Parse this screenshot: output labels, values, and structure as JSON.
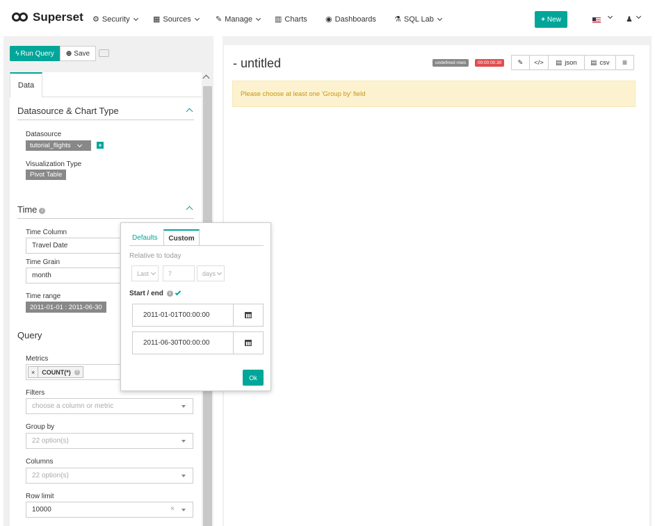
{
  "navbar": {
    "brand": "Superset",
    "items": [
      {
        "label": "Security",
        "icon": "gears-icon",
        "dropdown": true
      },
      {
        "label": "Sources",
        "icon": "table-icon",
        "dropdown": true
      },
      {
        "label": "Manage",
        "icon": "wrench-icon",
        "dropdown": true
      },
      {
        "label": "Charts",
        "icon": "bar-chart-icon",
        "dropdown": false
      },
      {
        "label": "Dashboards",
        "icon": "dashboard-icon",
        "dropdown": false
      },
      {
        "label": "SQL Lab",
        "icon": "flask-icon",
        "dropdown": true
      }
    ],
    "new_button": "New",
    "accent_color": "#00a699"
  },
  "toolbar": {
    "run_query": "Run Query",
    "save": "Save"
  },
  "sidebar": {
    "tab_label": "Data",
    "datasource_section": {
      "title": "Datasource & Chart Type",
      "datasource_label": "Datasource",
      "datasource_value": "tutorial_flights",
      "viz_type_label": "Visualization Type",
      "viz_type_value": "Pivot Table"
    },
    "time_section": {
      "title": "Time",
      "time_column_label": "Time Column",
      "time_column_value": "Travel Date",
      "time_grain_label": "Time Grain",
      "time_grain_value": "month",
      "time_range_label": "Time range",
      "time_range_value": "2011-01-01 : 2011-06-30"
    },
    "query_section": {
      "title": "Query",
      "metrics_label": "Metrics",
      "metric_value": "COUNT(*)",
      "filters_label": "Filters",
      "filters_placeholder": "choose a column or metric",
      "group_by_label": "Group by",
      "group_by_placeholder": "22 option(s)",
      "columns_label": "Columns",
      "columns_placeholder": "22 option(s)",
      "row_limit_label": "Row limit",
      "row_limit_value": "10000"
    }
  },
  "popover": {
    "tab_defaults": "Defaults",
    "tab_custom": "Custom",
    "relative_label": "Relative to today",
    "rel_last": "Last",
    "rel_num": "7",
    "rel_unit": "days",
    "start_end_label": "Start / end",
    "start_value": "2011-01-01T00:00:00",
    "end_value": "2011-06-30T00:00:00",
    "ok_label": "Ok"
  },
  "main": {
    "title": "- untitled",
    "rows_badge": "undefined rows",
    "timer_badge": "00:00:00.30",
    "json_label": "json",
    "csv_label": "csv",
    "alert": "Please choose at least one 'Group by' field"
  }
}
